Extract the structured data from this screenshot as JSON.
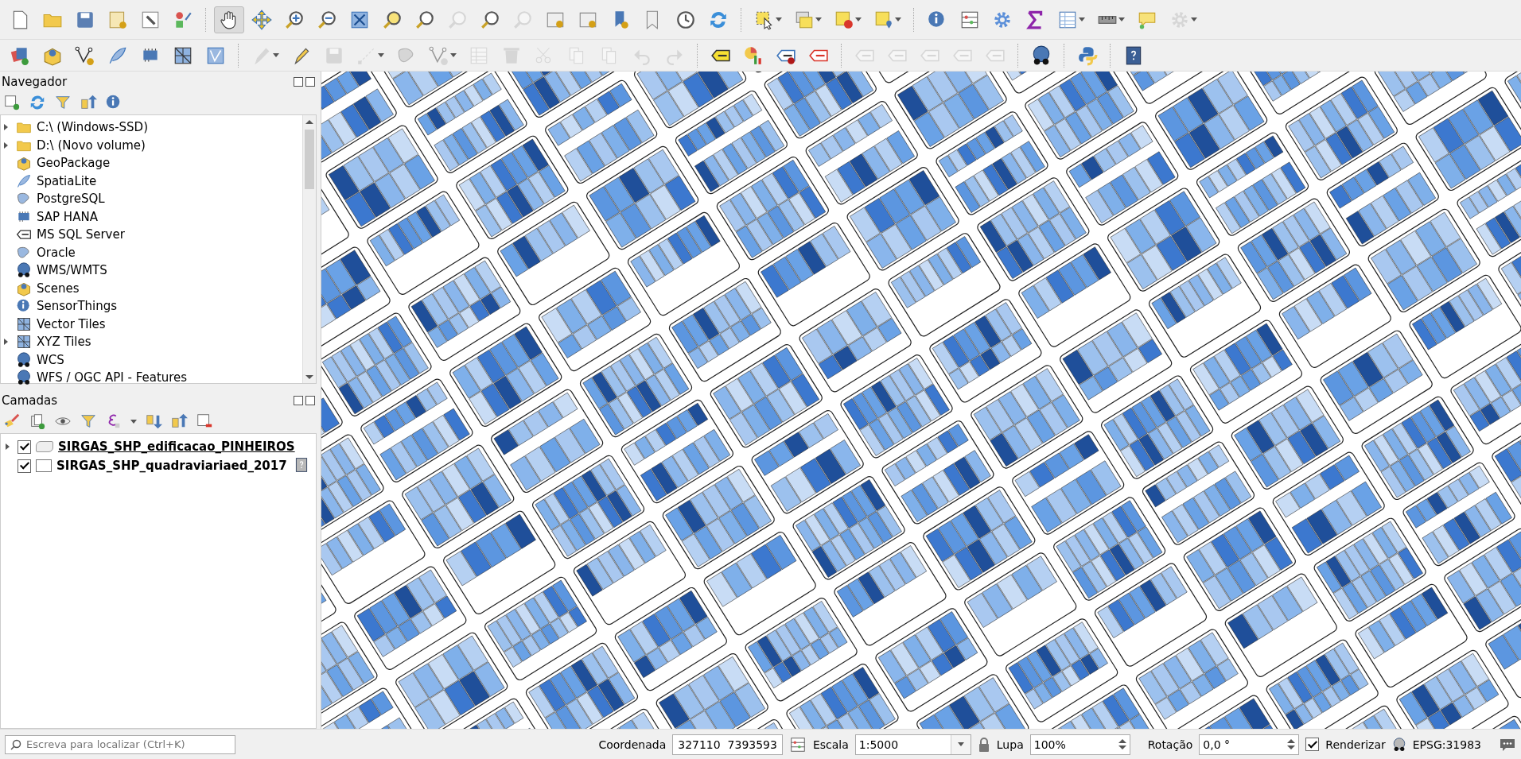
{
  "toolbar_1": [
    {
      "disabled": false,
      "selected": false
    },
    {
      "disabled": false,
      "selected": false
    },
    {
      "disabled": false,
      "selected": false
    },
    {
      "disabled": false,
      "selected": false
    },
    {
      "disabled": false,
      "selected": false
    },
    {
      "disabled": false,
      "selected": false
    },
    {
      "disabled": false,
      "selected": true
    },
    {
      "disabled": false,
      "selected": false
    },
    {
      "disabled": false,
      "selected": false
    },
    {
      "disabled": false,
      "selected": false
    },
    {
      "disabled": false,
      "selected": false
    },
    {
      "disabled": false,
      "selected": false
    },
    {
      "disabled": false,
      "selected": false
    },
    {
      "disabled": true,
      "selected": false
    },
    {
      "disabled": false,
      "selected": false
    },
    {
      "disabled": true,
      "selected": false
    },
    {
      "disabled": false,
      "selected": false
    },
    {
      "disabled": false,
      "selected": false
    },
    {
      "disabled": false,
      "selected": false
    },
    {
      "disabled": false,
      "selected": false
    },
    {
      "disabled": false,
      "selected": false
    },
    {
      "disabled": false,
      "selected": false
    },
    {
      "disabled": false,
      "selected": false
    },
    {
      "disabled": false,
      "selected": false
    },
    {
      "disabled": false,
      "selected": false
    },
    {
      "disabled": false,
      "selected": false
    },
    {
      "disabled": false,
      "selected": false
    },
    {
      "disabled": false,
      "selected": false
    },
    {
      "disabled": false,
      "selected": false
    },
    {
      "disabled": false,
      "selected": false
    },
    {
      "disabled": false,
      "selected": false
    },
    {
      "disabled": false,
      "selected": false
    },
    {
      "disabled": false,
      "selected": false
    },
    {
      "disabled": true,
      "selected": false
    }
  ],
  "toolbar_2": [
    {
      "disabled": false
    },
    {
      "disabled": false
    },
    {
      "disabled": false
    },
    {
      "disabled": false
    },
    {
      "disabled": false
    },
    {
      "disabled": false
    },
    {
      "disabled": false
    },
    {
      "disabled": true
    },
    {
      "disabled": false
    },
    {
      "disabled": true
    },
    {
      "disabled": true
    },
    {
      "disabled": true
    },
    {
      "disabled": true
    },
    {
      "disabled": true
    },
    {
      "disabled": true
    },
    {
      "disabled": true
    },
    {
      "disabled": true
    },
    {
      "disabled": true
    },
    {
      "disabled": true
    },
    {
      "disabled": true
    },
    {
      "disabled": false
    },
    {
      "disabled": false
    },
    {
      "disabled": false
    },
    {
      "disabled": false
    },
    {
      "disabled": true
    },
    {
      "disabled": true
    },
    {
      "disabled": true
    },
    {
      "disabled": true
    },
    {
      "disabled": true
    },
    {
      "disabled": false
    },
    {
      "disabled": false
    },
    {
      "disabled": false
    }
  ],
  "browser": {
    "title": "Navegador",
    "items": [
      {
        "label": "C:\\ (Windows-SSD)",
        "expandable": true
      },
      {
        "label": "D:\\ (Novo volume)",
        "expandable": true
      },
      {
        "label": "GeoPackage",
        "expandable": false
      },
      {
        "label": "SpatiaLite",
        "expandable": false
      },
      {
        "label": "PostgreSQL",
        "expandable": false
      },
      {
        "label": "SAP HANA",
        "expandable": false
      },
      {
        "label": "MS SQL Server",
        "expandable": false
      },
      {
        "label": "Oracle",
        "expandable": false
      },
      {
        "label": "WMS/WMTS",
        "expandable": false
      },
      {
        "label": "Scenes",
        "expandable": false
      },
      {
        "label": "SensorThings",
        "expandable": false
      },
      {
        "label": "Vector Tiles",
        "expandable": false
      },
      {
        "label": "XYZ Tiles",
        "expandable": true
      },
      {
        "label": "WCS",
        "expandable": false
      },
      {
        "label": "WFS / OGC API - Features",
        "expandable": false
      }
    ]
  },
  "layers": {
    "title": "Camadas",
    "items": [
      {
        "name": "SIRGAS_SHP_edificacao_PINHEIROS",
        "checked": true,
        "expandable": true,
        "current": true,
        "kind": "polygon"
      },
      {
        "name": "SIRGAS_SHP_quadraviariaed_2017",
        "checked": true,
        "expandable": false,
        "current": false,
        "kind": "unknown"
      }
    ]
  },
  "status_bar": {
    "search_placeholder": "Escreva para localizar (Ctrl+K)",
    "coordinate_label": "Coordenada",
    "coordinate": "327110  7393593",
    "scale_label": "Escala",
    "scale": "1:5000",
    "magnifier_label": "Lupa",
    "magnifier": "100%",
    "rotation_label": "Rotação",
    "rotation": "0,0 °",
    "render_label": "Renderizar",
    "render": true,
    "crs": "EPSG:31983"
  }
}
